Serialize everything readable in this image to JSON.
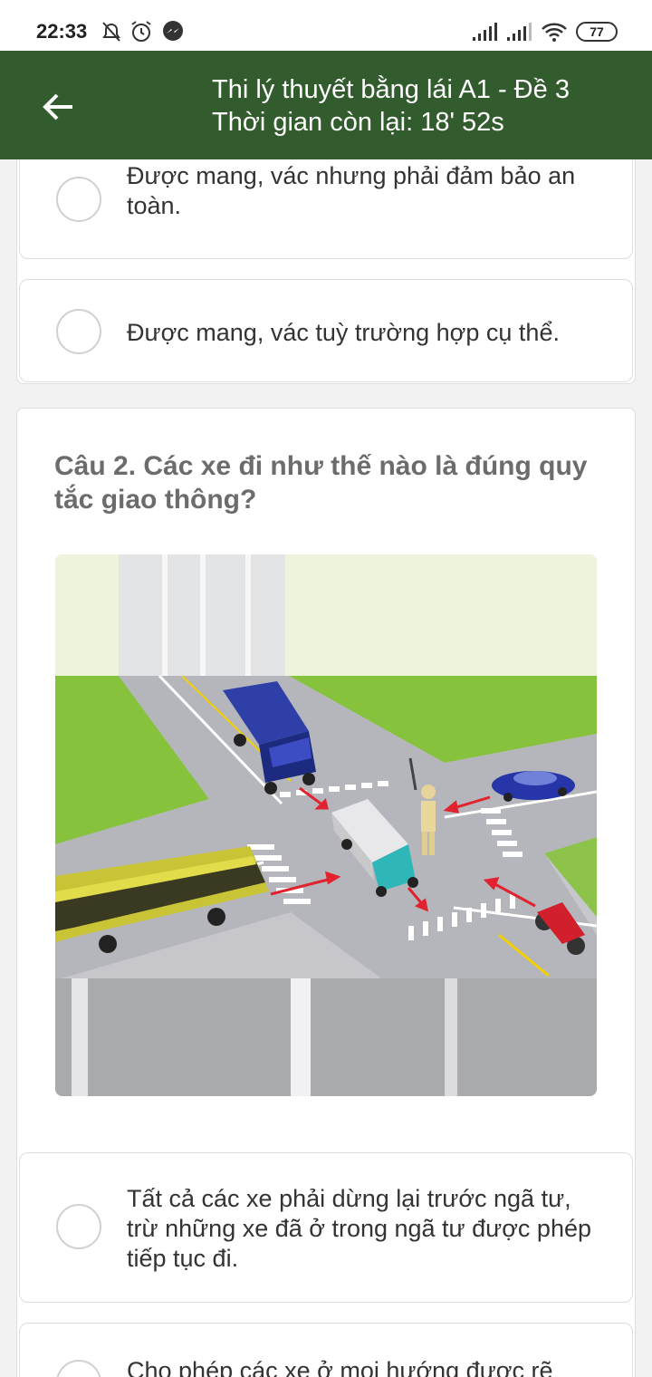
{
  "status_bar": {
    "time": "22:33",
    "battery": "77",
    "icons": [
      "mute-icon",
      "alarm-icon",
      "messenger-icon",
      "signal-icon",
      "signal-icon",
      "wifi-icon",
      "battery-icon"
    ]
  },
  "header": {
    "title": "Thi lý thuyết bằng lái A1 - Đề 3",
    "timer": "Thời gian còn lại: 18' 52s",
    "back_icon": "arrow-left-icon"
  },
  "question1": {
    "answers": [
      {
        "text": "Được mang, vác nhưng phải đảm bảo an toàn."
      },
      {
        "text": "Được mang, vác tuỳ trường hợp cụ thể."
      }
    ]
  },
  "question2": {
    "title": "Câu 2.  Các xe đi như thế nào là đúng quy tắc giao thông?",
    "answers": [
      {
        "text": "Tất cả các xe phải dừng lại trước ngã tư, trừ những xe đã ở trong ngã tư được phép tiếp tục đi."
      },
      {
        "text": "Cho phép các xe ở mọi hướng được rẽ"
      }
    ]
  },
  "colors": {
    "header_bg": "#335c2e",
    "question_text": "#6c6c6c",
    "grass": "#8cc63f",
    "road": "#c4c4c8"
  }
}
